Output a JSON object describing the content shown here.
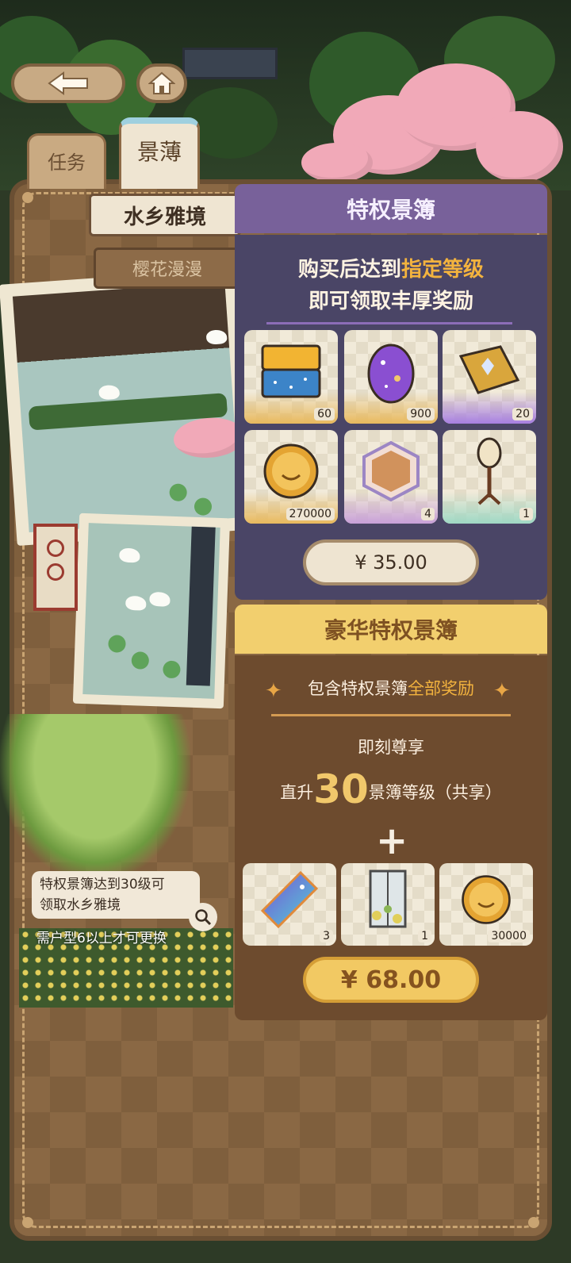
{
  "tabs": {
    "task": "任务",
    "scene_book": "景薄"
  },
  "scene": {
    "title": "水乡雅境",
    "subtitle": "樱花漫漫",
    "hint": "特权景簿达到30级可领取水乡雅境",
    "hint_line1": "特权景簿达到30级可",
    "hint_line2": "领取水乡雅境",
    "note": "需户型6以上才可更换"
  },
  "privilege": {
    "title": "特权景簿",
    "line1_prefix": "购买后达到",
    "line1_highlight": "指定等级",
    "line2": "即可领取丰厚奖励",
    "rewards": [
      {
        "icon": "gold-chest-icon",
        "count": "60"
      },
      {
        "icon": "galaxy-egg-icon",
        "count": "900"
      },
      {
        "icon": "golden-book-icon",
        "count": "20"
      },
      {
        "icon": "gold-coin-icon",
        "count": "270000"
      },
      {
        "icon": "hex-room-icon",
        "count": "4"
      },
      {
        "icon": "lantern-stand-icon",
        "count": "1"
      }
    ],
    "price": "¥ 35.00"
  },
  "deluxe": {
    "title": "豪华特权景簿",
    "include_prefix": "包含特权景簿",
    "include_highlight": "全部奖励",
    "enjoy": "即刻尊享",
    "level_prefix": "直升",
    "level_number": "30",
    "level_suffix": "景簿等级（共享）",
    "plus": "+",
    "rewards": [
      {
        "icon": "gradient-ticket-icon",
        "count": "3"
      },
      {
        "icon": "flower-window-icon",
        "count": "1"
      },
      {
        "icon": "gold-coin-icon",
        "count": "30000"
      }
    ],
    "price": "¥ 68.00"
  },
  "colors": {
    "privilege_header": "#78619a",
    "privilege_body": "#4a4566",
    "deluxe_header": "#f2cf6e",
    "deluxe_body": "#6d4b2e",
    "highlight": "#f3b33e"
  }
}
